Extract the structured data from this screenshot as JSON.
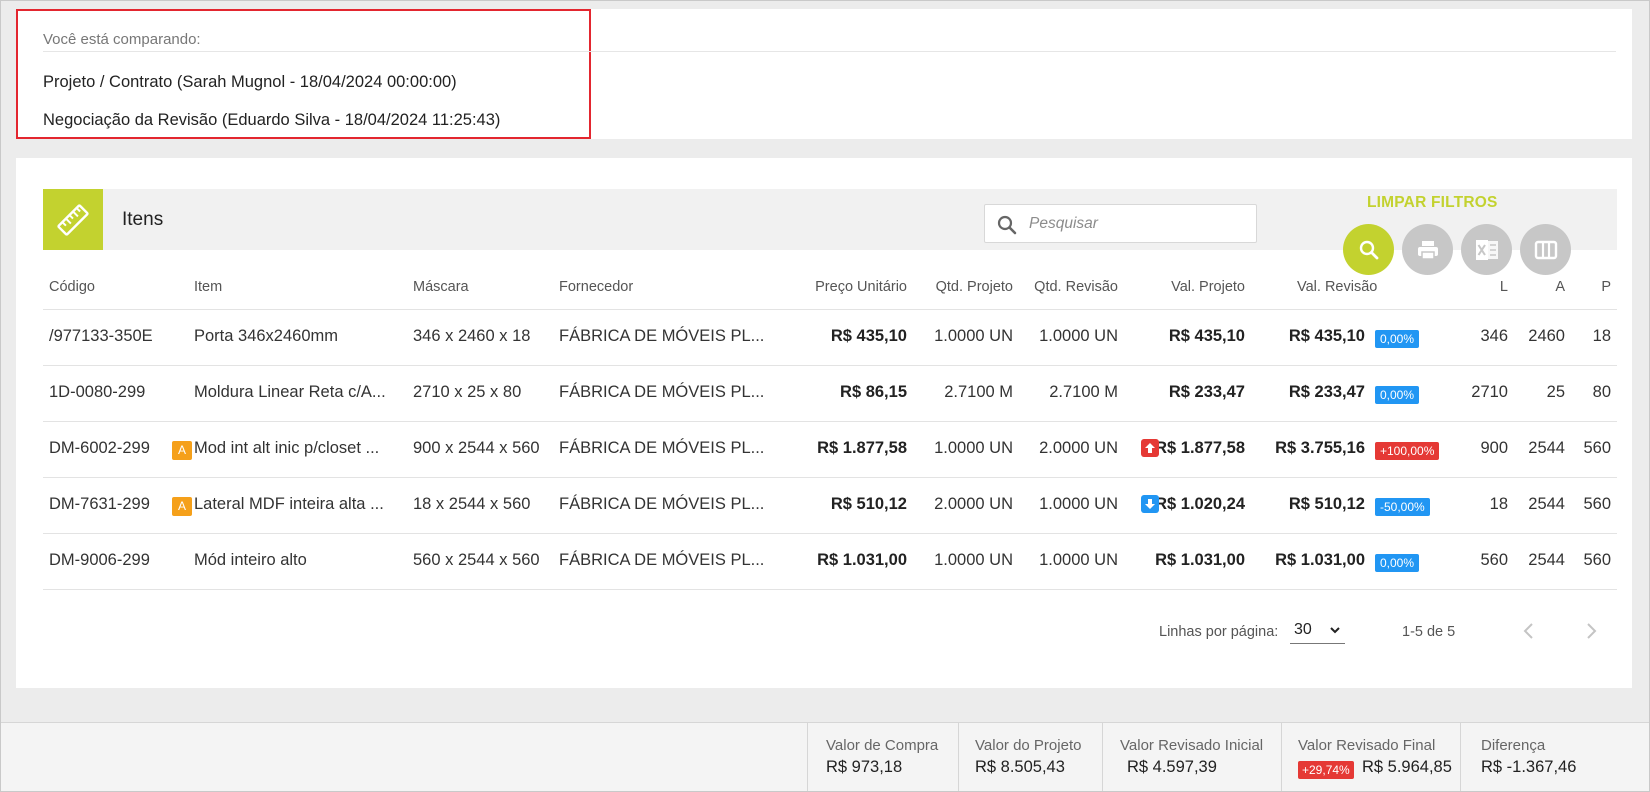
{
  "compare": {
    "label": "Você está comparando:",
    "line1": "Projeto / Contrato (Sarah Mugnol - 18/04/2024 00:00:00)",
    "line2": "Negociação da Revisão (Eduardo Silva - 18/04/2024 11:25:43)"
  },
  "items": {
    "title": "Itens",
    "icon": "ruler-icon",
    "search_placeholder": "Pesquisar",
    "clear_filters": "LIMPAR FILTROS",
    "accent_color": "#c3d22f"
  },
  "table": {
    "headers": {
      "codigo": "Código",
      "item": "Item",
      "mascara": "Máscara",
      "fornecedor": "Fornecedor",
      "preco_unitario": "Preço Unitário",
      "qtd_projeto": "Qtd. Projeto",
      "qtd_revisao": "Qtd. Revisão",
      "val_projeto": "Val. Projeto",
      "val_revisao": "Val. Revisão",
      "l": "L",
      "a": "A",
      "p": "P"
    },
    "rows": [
      {
        "codigo": "/977133-350E",
        "badge": "",
        "item": "Porta 346x2460mm",
        "mascara": "346 x 2460 x 18",
        "fornecedor": "FÁBRICA DE MÓVEIS PL...",
        "preco_unitario": "R$ 435,10",
        "qtd_projeto": "1.0000 UN",
        "qtd_revisao": "1.0000 UN",
        "arrow": "",
        "val_projeto": "R$ 435,10",
        "val_revisao": "R$ 435,10",
        "pct": "0,00%",
        "pct_color": "blue",
        "l": "346",
        "a": "2460",
        "p": "18"
      },
      {
        "codigo": "1D-0080-299",
        "badge": "",
        "item": "Moldura Linear Reta c/A...",
        "mascara": "2710 x 25 x 80",
        "fornecedor": "FÁBRICA DE MÓVEIS PL...",
        "preco_unitario": "R$ 86,15",
        "qtd_projeto": "2.7100 M",
        "qtd_revisao": "2.7100 M",
        "arrow": "",
        "val_projeto": "R$ 233,47",
        "val_revisao": "R$ 233,47",
        "pct": "0,00%",
        "pct_color": "blue",
        "l": "2710",
        "a": "25",
        "p": "80"
      },
      {
        "codigo": "DM-6002-299",
        "badge": "A",
        "item": "Mod int alt inic p/closet ...",
        "mascara": "900 x 2544 x 560",
        "fornecedor": "FÁBRICA DE MÓVEIS PL...",
        "preco_unitario": "R$ 1.877,58",
        "qtd_projeto": "1.0000 UN",
        "qtd_revisao": "2.0000 UN",
        "arrow": "up",
        "val_projeto": "R$ 1.877,58",
        "val_revisao": "R$ 3.755,16",
        "pct": "+100,00%",
        "pct_color": "red",
        "l": "900",
        "a": "2544",
        "p": "560"
      },
      {
        "codigo": "DM-7631-299",
        "badge": "A",
        "item": "Lateral MDF inteira alta ...",
        "mascara": "18 x 2544 x 560",
        "fornecedor": "FÁBRICA DE MÓVEIS PL...",
        "preco_unitario": "R$ 510,12",
        "qtd_projeto": "2.0000 UN",
        "qtd_revisao": "1.0000 UN",
        "arrow": "down",
        "val_projeto": "R$ 1.020,24",
        "val_revisao": "R$ 510,12",
        "pct": "-50,00%",
        "pct_color": "blue",
        "l": "18",
        "a": "2544",
        "p": "560"
      },
      {
        "codigo": "DM-9006-299",
        "badge": "",
        "item": "Mód inteiro alto",
        "mascara": "560 x 2544 x 560",
        "fornecedor": "FÁBRICA DE MÓVEIS PL...",
        "preco_unitario": "R$ 1.031,00",
        "qtd_projeto": "1.0000 UN",
        "qtd_revisao": "1.0000 UN",
        "arrow": "",
        "val_projeto": "R$ 1.031,00",
        "val_revisao": "R$ 1.031,00",
        "pct": "0,00%",
        "pct_color": "blue",
        "l": "560",
        "a": "2544",
        "p": "560"
      }
    ]
  },
  "pagination": {
    "rows_label": "Linhas por página:",
    "rows_value": "30",
    "range": "1-5 de 5"
  },
  "footer": {
    "valor_compra_label": "Valor de Compra",
    "valor_compra": "R$ 973,18",
    "valor_projeto_label": "Valor do Projeto",
    "valor_projeto": "R$ 8.505,43",
    "valor_rev_inicial_label": "Valor Revisado Inicial",
    "valor_rev_inicial": "R$ 4.597,39",
    "valor_rev_final_label": "Valor Revisado Final",
    "valor_rev_final_pct": "+29,74%",
    "valor_rev_final": "R$ 5.964,85",
    "diferenca_label": "Diferença",
    "diferenca": "R$ -1.367,46"
  }
}
